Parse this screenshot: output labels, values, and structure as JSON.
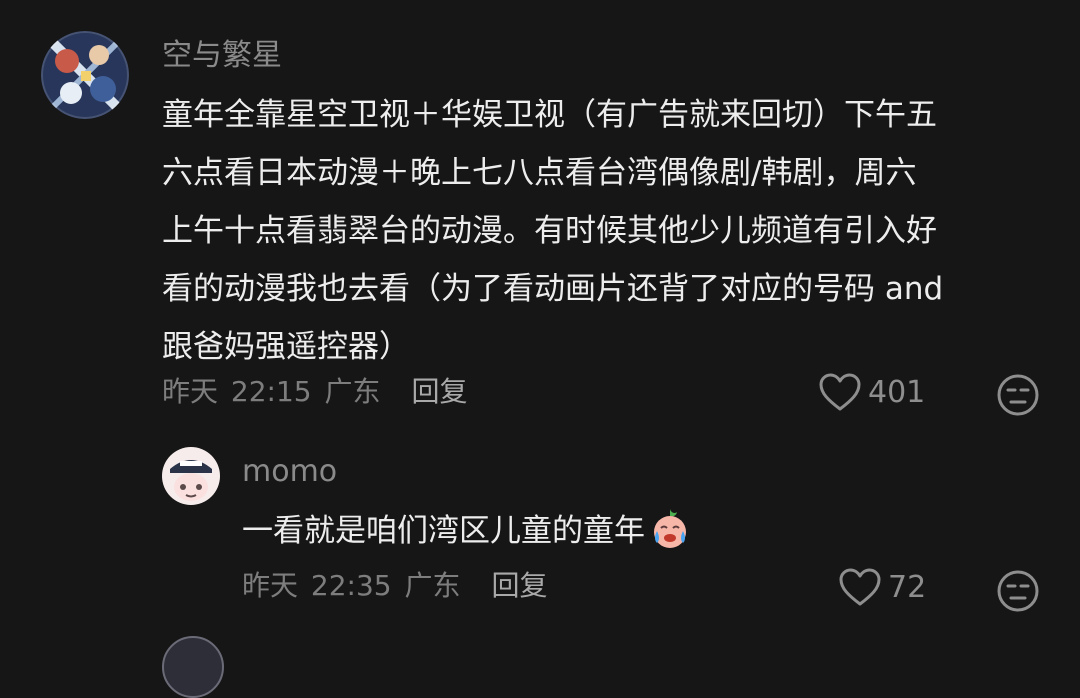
{
  "colors": {
    "background": "#161616",
    "username": "#8a8a8a",
    "body_text": "#ededed",
    "meta": "#7d7d7d",
    "reply": "#a9a9a9",
    "icon": "#8e8e8e"
  },
  "comments": [
    {
      "username": "空与繁星",
      "avatar_icon": "anime-avatar-icon",
      "lines": [
        "童年全靠星空卫视＋华娱卫视（有广告就来回切）下午五",
        "六点看日本动漫＋晚上七八点看台湾偶像剧/韩剧，周六",
        "上午十点看翡翠台的动漫。有时候其他少儿频道有引入好",
        "看的动漫我也去看（为了看动画片还背了对应的号码 and",
        "跟爸妈强遥控器）"
      ],
      "date": "昨天",
      "time": "22:15",
      "location": "广东",
      "reply_label": "回复",
      "likes": "401"
    },
    {
      "username": "momo",
      "avatar_icon": "cartoon-avatar-icon",
      "lines": [
        "一看就是咱们湾区儿童的童年"
      ],
      "inline_emoji": "crying-face-emoji",
      "date": "昨天",
      "time": "22:35",
      "location": "广东",
      "reply_label": "回复",
      "likes": "72"
    }
  ]
}
